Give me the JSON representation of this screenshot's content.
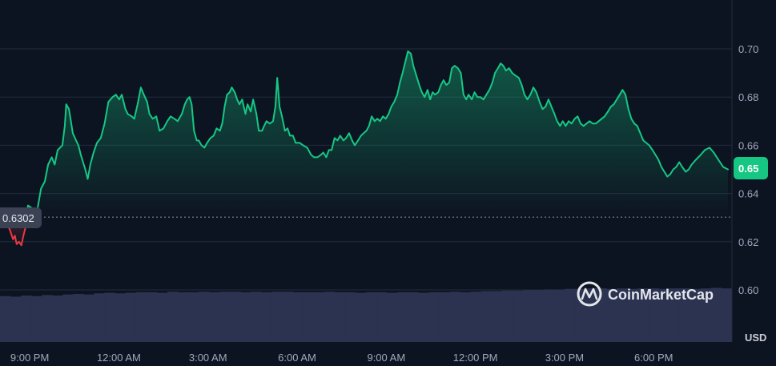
{
  "chart_data": {
    "type": "line",
    "currency": "USD",
    "watermark": "CoinMarketCap",
    "reference_price": 0.6302,
    "reference_label": "0.6302",
    "last_label": "0.65",
    "ylim": [
      0.59,
      0.72
    ],
    "y_ticks": [
      {
        "value": 0.6,
        "label": "0.60"
      },
      {
        "value": 0.62,
        "label": "0.62"
      },
      {
        "value": 0.64,
        "label": "0.64"
      },
      {
        "value": 0.66,
        "label": "0.66"
      },
      {
        "value": 0.68,
        "label": "0.68"
      },
      {
        "value": 0.7,
        "label": "0.70"
      }
    ],
    "time_range_hours": [
      0,
      24.5
    ],
    "x_ticks": [
      {
        "hour": 1.0,
        "label": "9:00 PM"
      },
      {
        "hour": 4.0,
        "label": "12:00 AM"
      },
      {
        "hour": 7.0,
        "label": "3:00 AM"
      },
      {
        "hour": 10.0,
        "label": "6:00 AM"
      },
      {
        "hour": 13.0,
        "label": "9:00 AM"
      },
      {
        "hour": 16.0,
        "label": "12:00 PM"
      },
      {
        "hour": 19.0,
        "label": "3:00 PM"
      },
      {
        "hour": 22.0,
        "label": "6:00 PM"
      }
    ],
    "colors": {
      "up": "#16c784",
      "down": "#ea3943",
      "volume": "#2b3351",
      "grid": "#222b3c",
      "background": "#0d1421"
    },
    "price_series": [
      [
        0.0,
        0.633
      ],
      [
        0.17,
        0.629
      ],
      [
        0.33,
        0.625
      ],
      [
        0.44,
        0.621
      ],
      [
        0.5,
        0.6225
      ],
      [
        0.56,
        0.619
      ],
      [
        0.64,
        0.62
      ],
      [
        0.72,
        0.6185
      ],
      [
        0.78,
        0.622
      ],
      [
        0.86,
        0.626
      ],
      [
        0.94,
        0.635
      ],
      [
        1.07,
        0.634
      ],
      [
        1.15,
        0.63
      ],
      [
        1.24,
        0.632
      ],
      [
        1.38,
        0.642
      ],
      [
        1.51,
        0.645
      ],
      [
        1.62,
        0.652
      ],
      [
        1.74,
        0.655
      ],
      [
        1.84,
        0.652
      ],
      [
        1.94,
        0.658
      ],
      [
        2.1,
        0.66
      ],
      [
        2.18,
        0.668
      ],
      [
        2.23,
        0.677
      ],
      [
        2.32,
        0.675
      ],
      [
        2.45,
        0.665
      ],
      [
        2.56,
        0.662
      ],
      [
        2.64,
        0.66
      ],
      [
        2.72,
        0.656
      ],
      [
        2.87,
        0.65
      ],
      [
        2.95,
        0.646
      ],
      [
        3.04,
        0.652
      ],
      [
        3.15,
        0.657
      ],
      [
        3.26,
        0.661
      ],
      [
        3.39,
        0.663
      ],
      [
        3.52,
        0.669
      ],
      [
        3.65,
        0.678
      ],
      [
        3.79,
        0.68
      ],
      [
        3.9,
        0.681
      ],
      [
        4.01,
        0.679
      ],
      [
        4.1,
        0.681
      ],
      [
        4.22,
        0.675
      ],
      [
        4.3,
        0.673
      ],
      [
        4.43,
        0.672
      ],
      [
        4.52,
        0.671
      ],
      [
        4.63,
        0.677
      ],
      [
        4.74,
        0.684
      ],
      [
        4.84,
        0.681
      ],
      [
        4.95,
        0.678
      ],
      [
        5.03,
        0.673
      ],
      [
        5.14,
        0.671
      ],
      [
        5.26,
        0.672
      ],
      [
        5.37,
        0.666
      ],
      [
        5.5,
        0.667
      ],
      [
        5.63,
        0.67
      ],
      [
        5.74,
        0.672
      ],
      [
        5.87,
        0.671
      ],
      [
        5.98,
        0.67
      ],
      [
        6.12,
        0.673
      ],
      [
        6.22,
        0.677
      ],
      [
        6.3,
        0.679
      ],
      [
        6.38,
        0.68
      ],
      [
        6.45,
        0.677
      ],
      [
        6.53,
        0.666
      ],
      [
        6.62,
        0.662
      ],
      [
        6.69,
        0.662
      ],
      [
        6.78,
        0.66
      ],
      [
        6.88,
        0.659
      ],
      [
        6.97,
        0.661
      ],
      [
        7.08,
        0.663
      ],
      [
        7.19,
        0.664
      ],
      [
        7.29,
        0.667
      ],
      [
        7.4,
        0.666
      ],
      [
        7.48,
        0.669
      ],
      [
        7.56,
        0.676
      ],
      [
        7.64,
        0.681
      ],
      [
        7.73,
        0.682
      ],
      [
        7.8,
        0.684
      ],
      [
        7.9,
        0.682
      ],
      [
        7.98,
        0.679
      ],
      [
        8.06,
        0.677
      ],
      [
        8.15,
        0.679
      ],
      [
        8.26,
        0.673
      ],
      [
        8.33,
        0.677
      ],
      [
        8.44,
        0.674
      ],
      [
        8.52,
        0.679
      ],
      [
        8.63,
        0.673
      ],
      [
        8.71,
        0.666
      ],
      [
        8.82,
        0.666
      ],
      [
        8.89,
        0.668
      ],
      [
        8.97,
        0.67
      ],
      [
        9.08,
        0.669
      ],
      [
        9.19,
        0.67
      ],
      [
        9.27,
        0.676
      ],
      [
        9.33,
        0.688
      ],
      [
        9.41,
        0.676
      ],
      [
        9.49,
        0.672
      ],
      [
        9.59,
        0.666
      ],
      [
        9.68,
        0.667
      ],
      [
        9.76,
        0.664
      ],
      [
        9.86,
        0.664
      ],
      [
        9.95,
        0.661
      ],
      [
        10.09,
        0.661
      ],
      [
        10.2,
        0.66
      ],
      [
        10.34,
        0.659
      ],
      [
        10.47,
        0.656
      ],
      [
        10.57,
        0.655
      ],
      [
        10.68,
        0.655
      ],
      [
        10.8,
        0.656
      ],
      [
        10.88,
        0.657
      ],
      [
        10.98,
        0.655
      ],
      [
        11.07,
        0.658
      ],
      [
        11.16,
        0.658
      ],
      [
        11.26,
        0.663
      ],
      [
        11.36,
        0.662
      ],
      [
        11.45,
        0.664
      ],
      [
        11.56,
        0.662
      ],
      [
        11.65,
        0.663
      ],
      [
        11.75,
        0.665
      ],
      [
        11.85,
        0.662
      ],
      [
        11.94,
        0.66
      ],
      [
        12.05,
        0.662
      ],
      [
        12.15,
        0.664
      ],
      [
        12.24,
        0.665
      ],
      [
        12.33,
        0.666
      ],
      [
        12.42,
        0.668
      ],
      [
        12.51,
        0.672
      ],
      [
        12.61,
        0.67
      ],
      [
        12.7,
        0.671
      ],
      [
        12.79,
        0.67
      ],
      [
        12.89,
        0.672
      ],
      [
        12.98,
        0.671
      ],
      [
        13.08,
        0.673
      ],
      [
        13.17,
        0.676
      ],
      [
        13.27,
        0.678
      ],
      [
        13.37,
        0.681
      ],
      [
        13.46,
        0.686
      ],
      [
        13.55,
        0.69
      ],
      [
        13.65,
        0.695
      ],
      [
        13.73,
        0.699
      ],
      [
        13.83,
        0.698
      ],
      [
        13.91,
        0.693
      ],
      [
        14.01,
        0.689
      ],
      [
        14.11,
        0.685
      ],
      [
        14.2,
        0.682
      ],
      [
        14.29,
        0.68
      ],
      [
        14.39,
        0.683
      ],
      [
        14.48,
        0.679
      ],
      [
        14.56,
        0.682
      ],
      [
        14.64,
        0.681
      ],
      [
        14.75,
        0.682
      ],
      [
        14.84,
        0.685
      ],
      [
        14.93,
        0.687
      ],
      [
        15.02,
        0.685
      ],
      [
        15.12,
        0.686
      ],
      [
        15.21,
        0.692
      ],
      [
        15.3,
        0.693
      ],
      [
        15.41,
        0.692
      ],
      [
        15.51,
        0.69
      ],
      [
        15.6,
        0.681
      ],
      [
        15.69,
        0.679
      ],
      [
        15.77,
        0.681
      ],
      [
        15.88,
        0.679
      ],
      [
        15.97,
        0.682
      ],
      [
        16.07,
        0.68
      ],
      [
        16.17,
        0.68
      ],
      [
        16.27,
        0.679
      ],
      [
        16.37,
        0.681
      ],
      [
        16.47,
        0.683
      ],
      [
        16.57,
        0.686
      ],
      [
        16.66,
        0.69
      ],
      [
        16.76,
        0.692
      ],
      [
        16.85,
        0.694
      ],
      [
        16.94,
        0.693
      ],
      [
        17.03,
        0.691
      ],
      [
        17.13,
        0.692
      ],
      [
        17.24,
        0.69
      ],
      [
        17.34,
        0.689
      ],
      [
        17.46,
        0.688
      ],
      [
        17.56,
        0.685
      ],
      [
        17.65,
        0.681
      ],
      [
        17.75,
        0.679
      ],
      [
        17.85,
        0.681
      ],
      [
        17.95,
        0.684
      ],
      [
        18.05,
        0.682
      ],
      [
        18.16,
        0.678
      ],
      [
        18.26,
        0.675
      ],
      [
        18.36,
        0.676
      ],
      [
        18.46,
        0.679
      ],
      [
        18.56,
        0.676
      ],
      [
        18.66,
        0.673
      ],
      [
        18.75,
        0.67
      ],
      [
        18.85,
        0.668
      ],
      [
        18.94,
        0.67
      ],
      [
        19.04,
        0.668
      ],
      [
        19.14,
        0.67
      ],
      [
        19.24,
        0.669
      ],
      [
        19.34,
        0.671
      ],
      [
        19.44,
        0.672
      ],
      [
        19.54,
        0.669
      ],
      [
        19.64,
        0.668
      ],
      [
        19.74,
        0.669
      ],
      [
        19.84,
        0.67
      ],
      [
        19.95,
        0.669
      ],
      [
        20.05,
        0.669
      ],
      [
        20.15,
        0.67
      ],
      [
        20.25,
        0.671
      ],
      [
        20.35,
        0.672
      ],
      [
        20.46,
        0.674
      ],
      [
        20.56,
        0.676
      ],
      [
        20.66,
        0.677
      ],
      [
        20.76,
        0.679
      ],
      [
        20.86,
        0.681
      ],
      [
        20.95,
        0.683
      ],
      [
        21.05,
        0.681
      ],
      [
        21.15,
        0.675
      ],
      [
        21.25,
        0.671
      ],
      [
        21.35,
        0.669
      ],
      [
        21.45,
        0.668
      ],
      [
        21.55,
        0.665
      ],
      [
        21.65,
        0.662
      ],
      [
        21.75,
        0.661
      ],
      [
        21.85,
        0.66
      ],
      [
        21.96,
        0.658
      ],
      [
        22.06,
        0.656
      ],
      [
        22.16,
        0.654
      ],
      [
        22.26,
        0.651
      ],
      [
        22.36,
        0.649
      ],
      [
        22.46,
        0.647
      ],
      [
        22.56,
        0.648
      ],
      [
        22.66,
        0.65
      ],
      [
        22.76,
        0.651
      ],
      [
        22.86,
        0.653
      ],
      [
        22.96,
        0.651
      ],
      [
        23.08,
        0.649
      ],
      [
        23.18,
        0.65
      ],
      [
        23.28,
        0.652
      ],
      [
        23.42,
        0.654
      ],
      [
        23.58,
        0.656
      ],
      [
        23.72,
        0.658
      ],
      [
        23.88,
        0.659
      ],
      [
        24.02,
        0.657
      ],
      [
        24.18,
        0.654
      ],
      [
        24.34,
        0.651
      ],
      [
        24.5,
        0.65
      ]
    ],
    "volume_fraction": [
      0.83,
      0.82,
      0.84,
      0.83,
      0.85,
      0.84,
      0.86,
      0.87,
      0.86,
      0.88,
      0.89,
      0.88,
      0.89,
      0.9,
      0.9,
      0.89,
      0.91,
      0.9,
      0.9,
      0.91,
      0.9,
      0.91,
      0.91,
      0.9,
      0.91,
      0.9,
      0.91,
      0.91,
      0.9,
      0.9,
      0.9,
      0.91,
      0.9,
      0.9,
      0.89,
      0.9,
      0.9,
      0.89,
      0.9,
      0.9,
      0.89,
      0.9,
      0.9,
      0.91,
      0.9,
      0.91,
      0.92,
      0.92,
      0.93,
      0.93,
      0.94,
      0.94,
      0.95,
      0.95,
      0.96,
      0.96,
      0.97,
      0.97,
      0.96,
      0.97,
      0.96,
      0.97,
      0.97,
      0.96,
      0.97,
      0.97,
      0.96,
      0.97,
      0.98,
      0.97
    ]
  }
}
